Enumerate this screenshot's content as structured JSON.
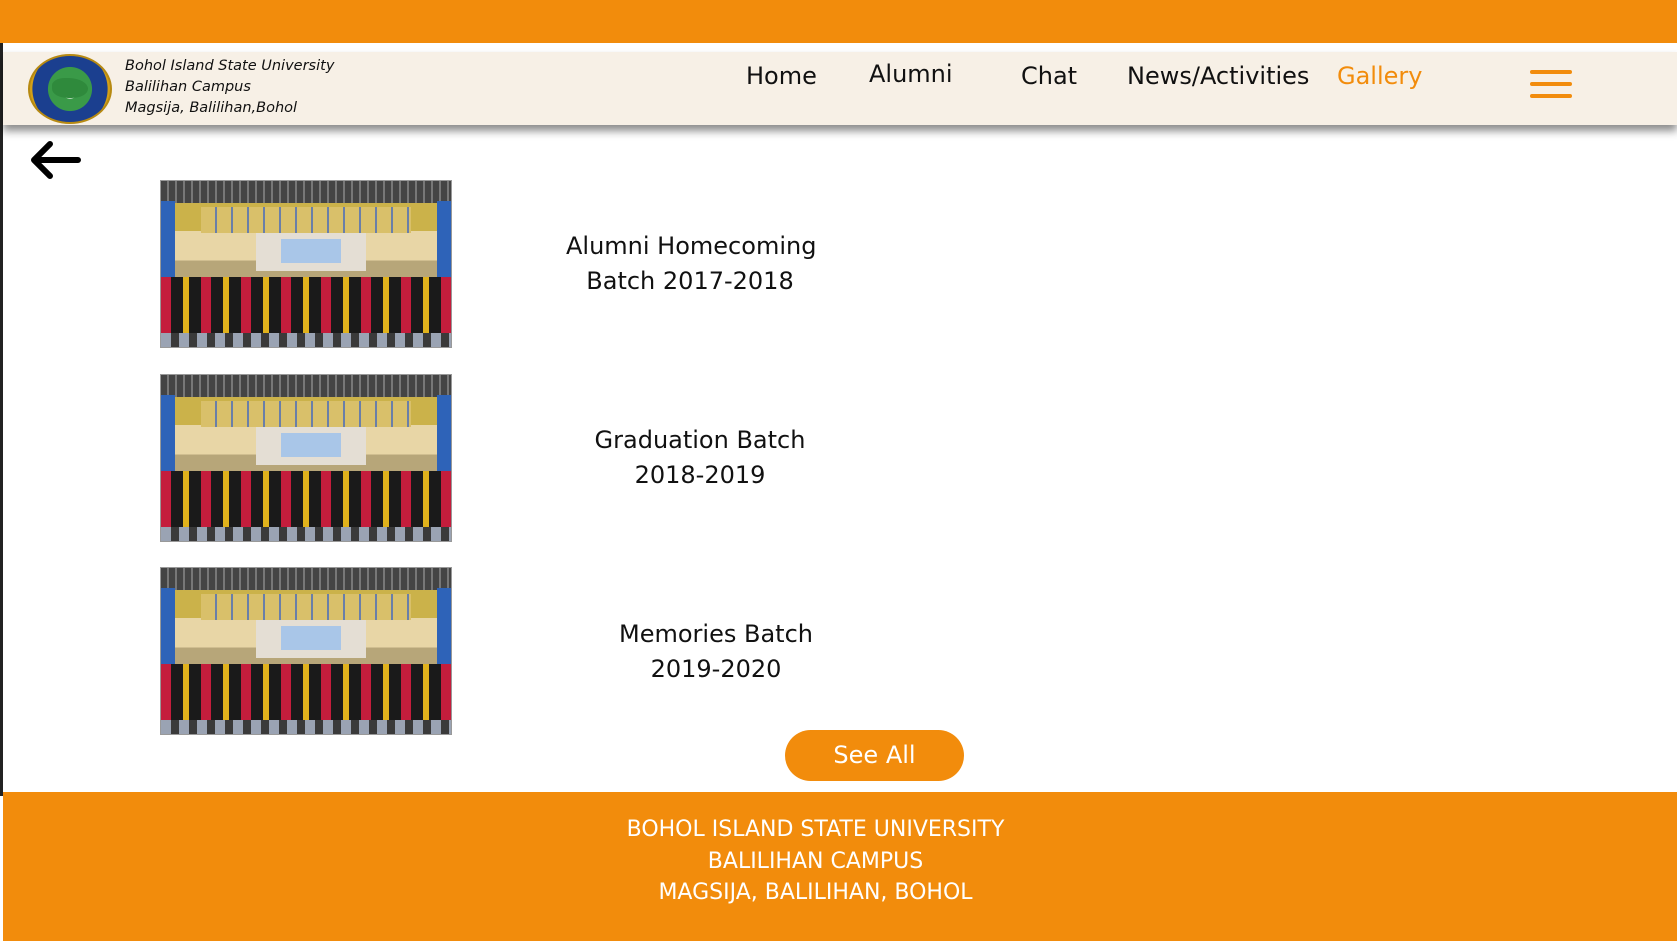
{
  "colors": {
    "accent": "#f28c0c",
    "header_bg": "#f7f0e6",
    "text": "#111111",
    "on_accent": "#ffffff"
  },
  "header": {
    "logo_icon": "university-seal-icon",
    "university": "Bohol Island State University",
    "campus": "Balilihan Campus",
    "address": "Magsija, Balilihan,Bohol",
    "nav": {
      "home": "Home",
      "alumni": "Alumni",
      "chat": "Chat",
      "news": "News/Activities",
      "gallery": "Gallery"
    },
    "active_nav": "Gallery",
    "menu_icon": "hamburger-menu-icon"
  },
  "back_icon": "arrow-left-icon",
  "gallery": {
    "items": [
      {
        "line1": "Alumni Homecoming",
        "line2": "Batch 2017-2018"
      },
      {
        "line1": "Graduation Batch",
        "line2": "2018-2019"
      },
      {
        "line1": "Memories Batch",
        "line2": "2019-2020"
      }
    ],
    "see_all": "See All"
  },
  "footer": {
    "line1": "BOHOL ISLAND STATE UNIVERSITY",
    "line2": "BALILIHAN CAMPUS",
    "line3": "MAGSIJA, BALILIHAN, BOHOL"
  }
}
